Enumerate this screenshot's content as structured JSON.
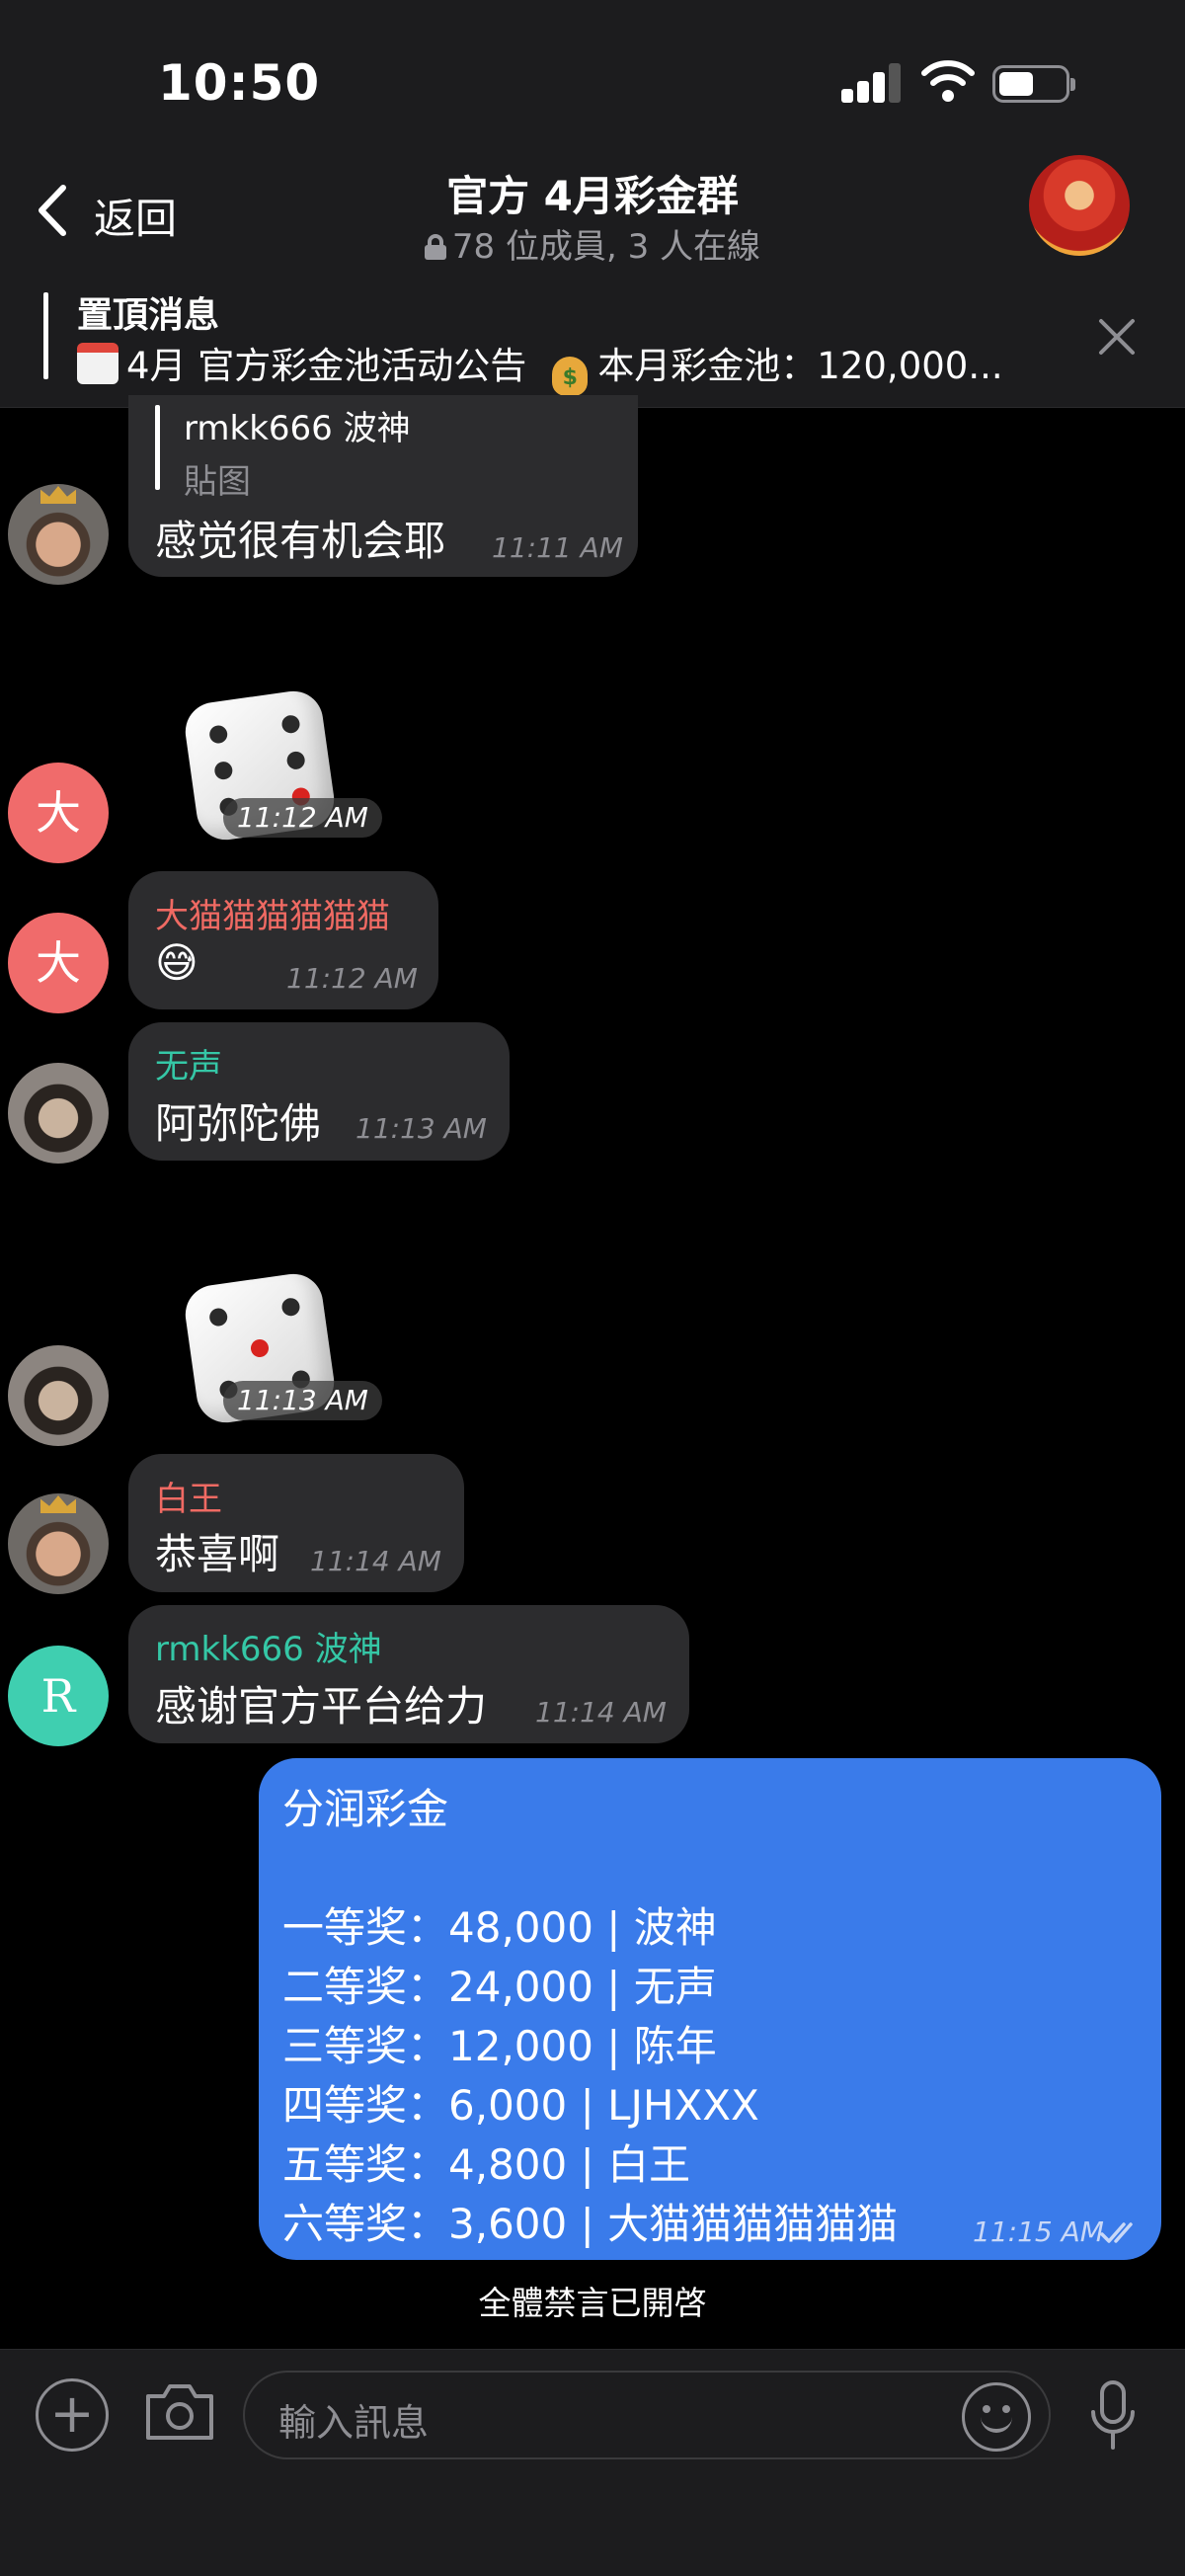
{
  "status": {
    "time": "10:50"
  },
  "header": {
    "back_label": "返回",
    "title": "官方 4月彩金群",
    "subtitle": "78 位成員, 3 人在線"
  },
  "pinned": {
    "title": "置頂消息",
    "text_part1": "4月 官方彩金池活动公告",
    "text_part2": "本月彩金池：120,000..."
  },
  "messages": {
    "m1": {
      "reply_name": "rmkk666 波神",
      "reply_text": "貼图",
      "text": "感觉很有机会耶",
      "time": "11:11 AM"
    },
    "dice1": {
      "time": "11:12 AM"
    },
    "m2": {
      "avatar_letter": "大",
      "sender": "大猫猫猫猫猫猫",
      "text": "😅",
      "time": "11:12 AM"
    },
    "m3": {
      "sender": "无声",
      "text": "阿弥陀佛",
      "time": "11:13 AM"
    },
    "dice2": {
      "time": "11:13 AM"
    },
    "m4": {
      "sender": "白王",
      "text": "恭喜啊",
      "time": "11:14 AM"
    },
    "m5": {
      "avatar_letter": "R",
      "sender": "rmkk666 波神",
      "text": "感谢官方平台给力",
      "time": "11:14 AM"
    }
  },
  "outgoing": {
    "title": "分润彩金",
    "lines": [
      "一等奖：48,000 | 波神",
      "二等奖：24,000 | 无声",
      "三等奖：12,000 | 陈年",
      "四等奖：6,000 | LJHXXX",
      "五等奖：4,800 | 白王",
      "六等奖：3,600 | 大猫猫猫猫猫猫"
    ],
    "time": "11:15 AM"
  },
  "system_message": "全體禁言已開啓",
  "input": {
    "placeholder": "輸入訊息"
  },
  "colors": {
    "outgoing_bubble": "#3a7bea",
    "sender_red": "#f06a63",
    "sender_teal": "#35c7a6",
    "incoming_bubble": "#2c2c2e"
  }
}
